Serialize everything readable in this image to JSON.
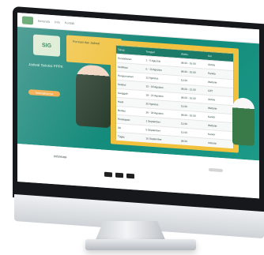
{
  "browser": {
    "title": ""
  },
  "site": {
    "logo": "logo",
    "nav": [
      "Beranda",
      "Info",
      "Kontak"
    ]
  },
  "hero": {
    "badge": "SIG",
    "headline": "Jadwal Seleksi PPPK",
    "subtext": "Formasi dan Jadwal",
    "cta": "Selengkapnya",
    "table": {
      "headers": [
        "Tahap",
        "Tanggal",
        "Waktu",
        "Ket"
      ],
      "rows": [
        [
          "Pendaftaran",
          "1 - 5 Agustus",
          "08.00 - 16.00",
          "Online"
        ],
        [
          "Verifikasi",
          "6 - 10 Agustus",
          "08.00 - 16.00",
          "Panitia"
        ],
        [
          "Pengumuman",
          "12 Agustus",
          "10.00",
          "Website"
        ],
        [
          "Seleksi",
          "15 - 18 Agustus",
          "08.00 - 12.00",
          "CAT"
        ],
        [
          "Sanggah",
          "19 - 21 Agustus",
          "08.00 - 16.00",
          "Online"
        ],
        [
          "Hasil",
          "25 Agustus",
          "10.00",
          "Website"
        ],
        [
          "Berkas",
          "26 - 30 Agustus",
          "08.00 - 16.00",
          "Kantor"
        ],
        [
          "Penetapan",
          "1 September",
          "10.00",
          "Website"
        ],
        [
          "SK",
          "5 September",
          "10.00",
          "Kantor"
        ],
        [
          "Tugas",
          "10 September",
          "08.00",
          "Instansi"
        ]
      ]
    }
  },
  "content": {
    "title": "Informasi"
  }
}
